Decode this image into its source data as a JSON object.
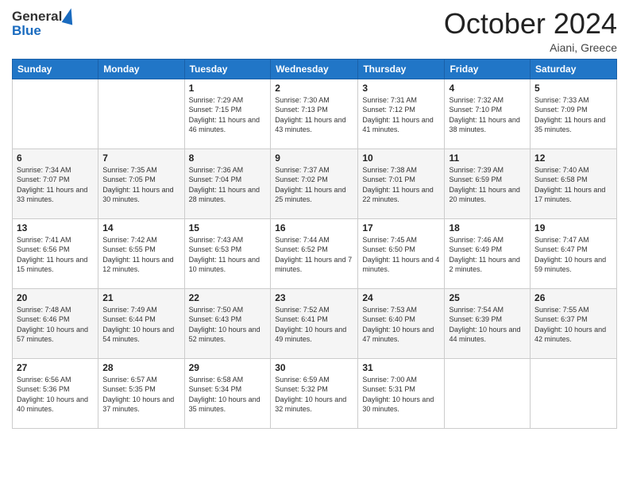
{
  "header": {
    "logo_line1": "General",
    "logo_line2": "Blue",
    "month": "October 2024",
    "location": "Aiani, Greece"
  },
  "weekdays": [
    "Sunday",
    "Monday",
    "Tuesday",
    "Wednesday",
    "Thursday",
    "Friday",
    "Saturday"
  ],
  "weeks": [
    [
      {
        "day": "",
        "info": ""
      },
      {
        "day": "",
        "info": ""
      },
      {
        "day": "1",
        "info": "Sunrise: 7:29 AM\nSunset: 7:15 PM\nDaylight: 11 hours and 46 minutes."
      },
      {
        "day": "2",
        "info": "Sunrise: 7:30 AM\nSunset: 7:13 PM\nDaylight: 11 hours and 43 minutes."
      },
      {
        "day": "3",
        "info": "Sunrise: 7:31 AM\nSunset: 7:12 PM\nDaylight: 11 hours and 41 minutes."
      },
      {
        "day": "4",
        "info": "Sunrise: 7:32 AM\nSunset: 7:10 PM\nDaylight: 11 hours and 38 minutes."
      },
      {
        "day": "5",
        "info": "Sunrise: 7:33 AM\nSunset: 7:09 PM\nDaylight: 11 hours and 35 minutes."
      }
    ],
    [
      {
        "day": "6",
        "info": "Sunrise: 7:34 AM\nSunset: 7:07 PM\nDaylight: 11 hours and 33 minutes."
      },
      {
        "day": "7",
        "info": "Sunrise: 7:35 AM\nSunset: 7:05 PM\nDaylight: 11 hours and 30 minutes."
      },
      {
        "day": "8",
        "info": "Sunrise: 7:36 AM\nSunset: 7:04 PM\nDaylight: 11 hours and 28 minutes."
      },
      {
        "day": "9",
        "info": "Sunrise: 7:37 AM\nSunset: 7:02 PM\nDaylight: 11 hours and 25 minutes."
      },
      {
        "day": "10",
        "info": "Sunrise: 7:38 AM\nSunset: 7:01 PM\nDaylight: 11 hours and 22 minutes."
      },
      {
        "day": "11",
        "info": "Sunrise: 7:39 AM\nSunset: 6:59 PM\nDaylight: 11 hours and 20 minutes."
      },
      {
        "day": "12",
        "info": "Sunrise: 7:40 AM\nSunset: 6:58 PM\nDaylight: 11 hours and 17 minutes."
      }
    ],
    [
      {
        "day": "13",
        "info": "Sunrise: 7:41 AM\nSunset: 6:56 PM\nDaylight: 11 hours and 15 minutes."
      },
      {
        "day": "14",
        "info": "Sunrise: 7:42 AM\nSunset: 6:55 PM\nDaylight: 11 hours and 12 minutes."
      },
      {
        "day": "15",
        "info": "Sunrise: 7:43 AM\nSunset: 6:53 PM\nDaylight: 11 hours and 10 minutes."
      },
      {
        "day": "16",
        "info": "Sunrise: 7:44 AM\nSunset: 6:52 PM\nDaylight: 11 hours and 7 minutes."
      },
      {
        "day": "17",
        "info": "Sunrise: 7:45 AM\nSunset: 6:50 PM\nDaylight: 11 hours and 4 minutes."
      },
      {
        "day": "18",
        "info": "Sunrise: 7:46 AM\nSunset: 6:49 PM\nDaylight: 11 hours and 2 minutes."
      },
      {
        "day": "19",
        "info": "Sunrise: 7:47 AM\nSunset: 6:47 PM\nDaylight: 10 hours and 59 minutes."
      }
    ],
    [
      {
        "day": "20",
        "info": "Sunrise: 7:48 AM\nSunset: 6:46 PM\nDaylight: 10 hours and 57 minutes."
      },
      {
        "day": "21",
        "info": "Sunrise: 7:49 AM\nSunset: 6:44 PM\nDaylight: 10 hours and 54 minutes."
      },
      {
        "day": "22",
        "info": "Sunrise: 7:50 AM\nSunset: 6:43 PM\nDaylight: 10 hours and 52 minutes."
      },
      {
        "day": "23",
        "info": "Sunrise: 7:52 AM\nSunset: 6:41 PM\nDaylight: 10 hours and 49 minutes."
      },
      {
        "day": "24",
        "info": "Sunrise: 7:53 AM\nSunset: 6:40 PM\nDaylight: 10 hours and 47 minutes."
      },
      {
        "day": "25",
        "info": "Sunrise: 7:54 AM\nSunset: 6:39 PM\nDaylight: 10 hours and 44 minutes."
      },
      {
        "day": "26",
        "info": "Sunrise: 7:55 AM\nSunset: 6:37 PM\nDaylight: 10 hours and 42 minutes."
      }
    ],
    [
      {
        "day": "27",
        "info": "Sunrise: 6:56 AM\nSunset: 5:36 PM\nDaylight: 10 hours and 40 minutes."
      },
      {
        "day": "28",
        "info": "Sunrise: 6:57 AM\nSunset: 5:35 PM\nDaylight: 10 hours and 37 minutes."
      },
      {
        "day": "29",
        "info": "Sunrise: 6:58 AM\nSunset: 5:34 PM\nDaylight: 10 hours and 35 minutes."
      },
      {
        "day": "30",
        "info": "Sunrise: 6:59 AM\nSunset: 5:32 PM\nDaylight: 10 hours and 32 minutes."
      },
      {
        "day": "31",
        "info": "Sunrise: 7:00 AM\nSunset: 5:31 PM\nDaylight: 10 hours and 30 minutes."
      },
      {
        "day": "",
        "info": ""
      },
      {
        "day": "",
        "info": ""
      }
    ]
  ]
}
